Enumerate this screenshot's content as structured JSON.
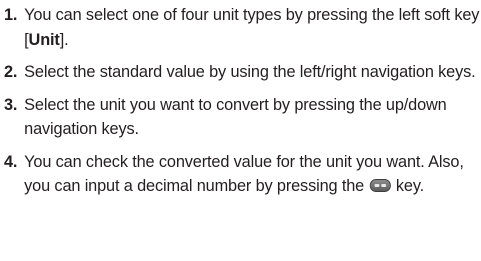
{
  "steps": [
    {
      "number": "1.",
      "text_before": "You can select one of four unit types by pressing the left soft key [",
      "bold": "Unit",
      "text_after": "]."
    },
    {
      "number": "2.",
      "text": "Select the standard value by using the left/right navigation keys."
    },
    {
      "number": "3.",
      "text": "Select the unit you want to convert by pressing the up/down navigation keys."
    },
    {
      "number": "4.",
      "text_before": "You can check the converted value for the unit you want. Also, you can input a decimal number by pressing the",
      "icon": "star-hash-key-icon",
      "text_after": "key."
    }
  ]
}
